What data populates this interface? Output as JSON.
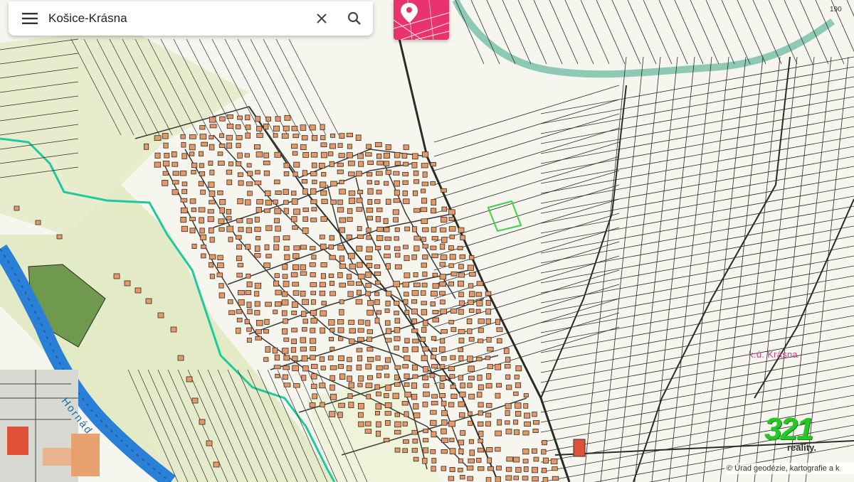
{
  "search": {
    "query": "Košice-Krásna"
  },
  "icons": {
    "menu": "menu-icon",
    "clear": "close-icon",
    "search": "search-icon",
    "logo": "map-pin-icon"
  },
  "map": {
    "parcel_area_label": "k.ú. Krásna",
    "river_label": "Hornád",
    "corner_number": "190"
  },
  "watermark": {
    "number": "321",
    "text": "reality."
  },
  "attribution": "© Úrad geodézie, kartografie a k",
  "colors": {
    "background": "#f6f6ee",
    "field_green": "#e8efd0",
    "parcel_line": "#2b2b2b",
    "building": "#e39a6a",
    "river": "#2a7fd6",
    "boundary": "#1fc9a0",
    "selected_parcel": "#3fd23f",
    "accent_pink": "#e8336e",
    "label_pink": "#d04090"
  }
}
